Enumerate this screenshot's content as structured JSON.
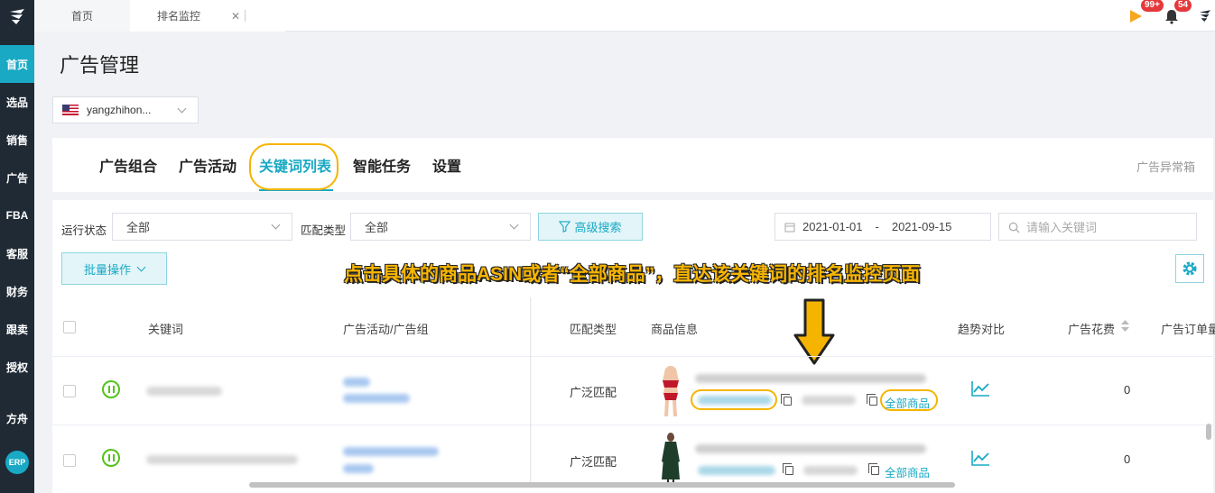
{
  "sidebar": {
    "items": [
      {
        "label": "首页",
        "active": true
      },
      {
        "label": "选品"
      },
      {
        "label": "销售"
      },
      {
        "label": "广告"
      },
      {
        "label": "FBA"
      },
      {
        "label": "客服"
      },
      {
        "label": "财务"
      },
      {
        "label": "跟卖"
      },
      {
        "label": "授权"
      },
      {
        "label": "方舟"
      }
    ],
    "erp_label": "ERP"
  },
  "topbar": {
    "tabs": [
      {
        "label": "首页"
      },
      {
        "label": "排名监控",
        "close": "✕"
      }
    ],
    "badges": {
      "messages": "99+",
      "notifications": "54"
    }
  },
  "page": {
    "title": "广告管理"
  },
  "store": {
    "name": "yangzhihon..."
  },
  "main_tabs": [
    {
      "label": "广告组合"
    },
    {
      "label": "广告活动"
    },
    {
      "label": "关键词列表",
      "active": true
    },
    {
      "label": "智能任务"
    },
    {
      "label": "设置"
    }
  ],
  "alert_link": "广告异常箱",
  "filters": {
    "run_status_label": "运行状态",
    "run_status_value": "全部",
    "match_type_label": "匹配类型",
    "match_type_value": "全部",
    "advanced_search": "高级搜索",
    "date_start": "2021-01-01",
    "date_sep": "-",
    "date_end": "2021-09-15",
    "keyword_placeholder": "请输入关键词",
    "batch_ops": "批量操作"
  },
  "annotation": "点击具体的商品ASIN或者“全部商品”，直达该关键词的排名监控页面",
  "table": {
    "headers": [
      "关键词",
      "广告活动/广告组",
      "匹配类型",
      "商品信息",
      "趋势对比",
      "广告花费",
      "广告订单量"
    ],
    "rows": [
      {
        "match_type": "广泛匹配",
        "all_products": "全部商品",
        "spend": "0"
      },
      {
        "match_type": "广泛匹配",
        "all_products": "全部商品",
        "spend": "0"
      }
    ]
  },
  "colors": {
    "accent": "#19a9c4",
    "sidebar": "#1f2a35",
    "highlight": "#f5b400",
    "status_active": "#52c41a"
  }
}
